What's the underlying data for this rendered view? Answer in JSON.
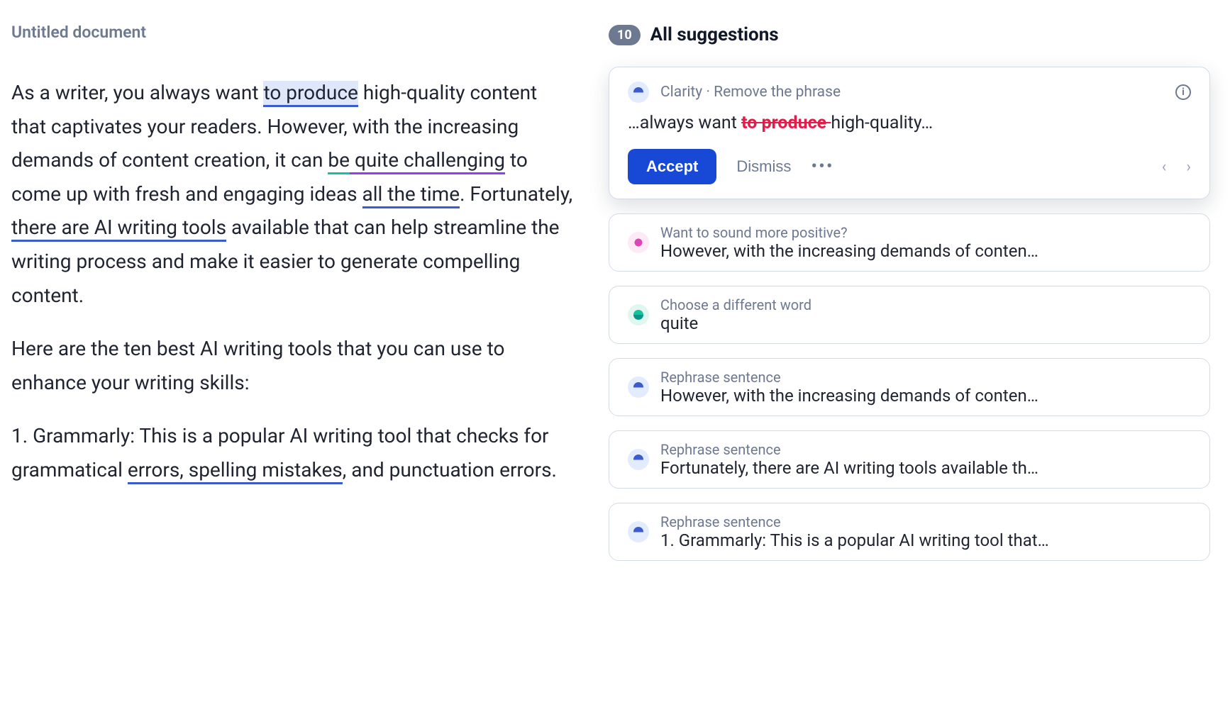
{
  "document": {
    "title": "Untitled document",
    "p1": {
      "t1": "As a writer, you always want ",
      "hl": "to produce",
      "t2": " high-quality content that captivates your readers. However, with the increasing demands of content creation, it can ",
      "u1a": "be",
      "u1b": " quite challenging",
      "t3": " to come up with fresh and engaging ideas ",
      "u2": "all the time",
      "t4": ". Fortunately, ",
      "u3": "there are AI writing tools",
      "t5": " available that can help streamline the writing process and make it easier to generate compelling content."
    },
    "p2": "Here are the ten best AI writing tools that you can use to enhance your writing skills:",
    "p3": {
      "t1": "1. Grammarly: This is a popular AI writing tool that checks for grammatical ",
      "u1": "errors, spelling mistakes",
      "t2": ", and punctuation errors."
    }
  },
  "sidebar": {
    "count": "10",
    "title": "All suggestions",
    "active": {
      "category": "Clarity",
      "sep": " · ",
      "action_label": "Remove the phrase",
      "snippet_before": "…always want ",
      "snippet_strike": "to produce ",
      "snippet_after": "high-quality…",
      "accept": "Accept",
      "dismiss": "Dismiss"
    },
    "items": [
      {
        "icon": "pink",
        "label": "Want to sound more positive?",
        "text": "However, with the increasing demands of conten…"
      },
      {
        "icon": "green",
        "label": "Choose a different word",
        "text": "quite"
      },
      {
        "icon": "blue",
        "label": "Rephrase sentence",
        "text": "However, with the increasing demands of conten…"
      },
      {
        "icon": "blue",
        "label": "Rephrase sentence",
        "text": "Fortunately, there are AI writing tools available th…"
      },
      {
        "icon": "blue",
        "label": "Rephrase sentence",
        "text": "1. Grammarly: This is a popular AI writing tool that…"
      }
    ]
  }
}
